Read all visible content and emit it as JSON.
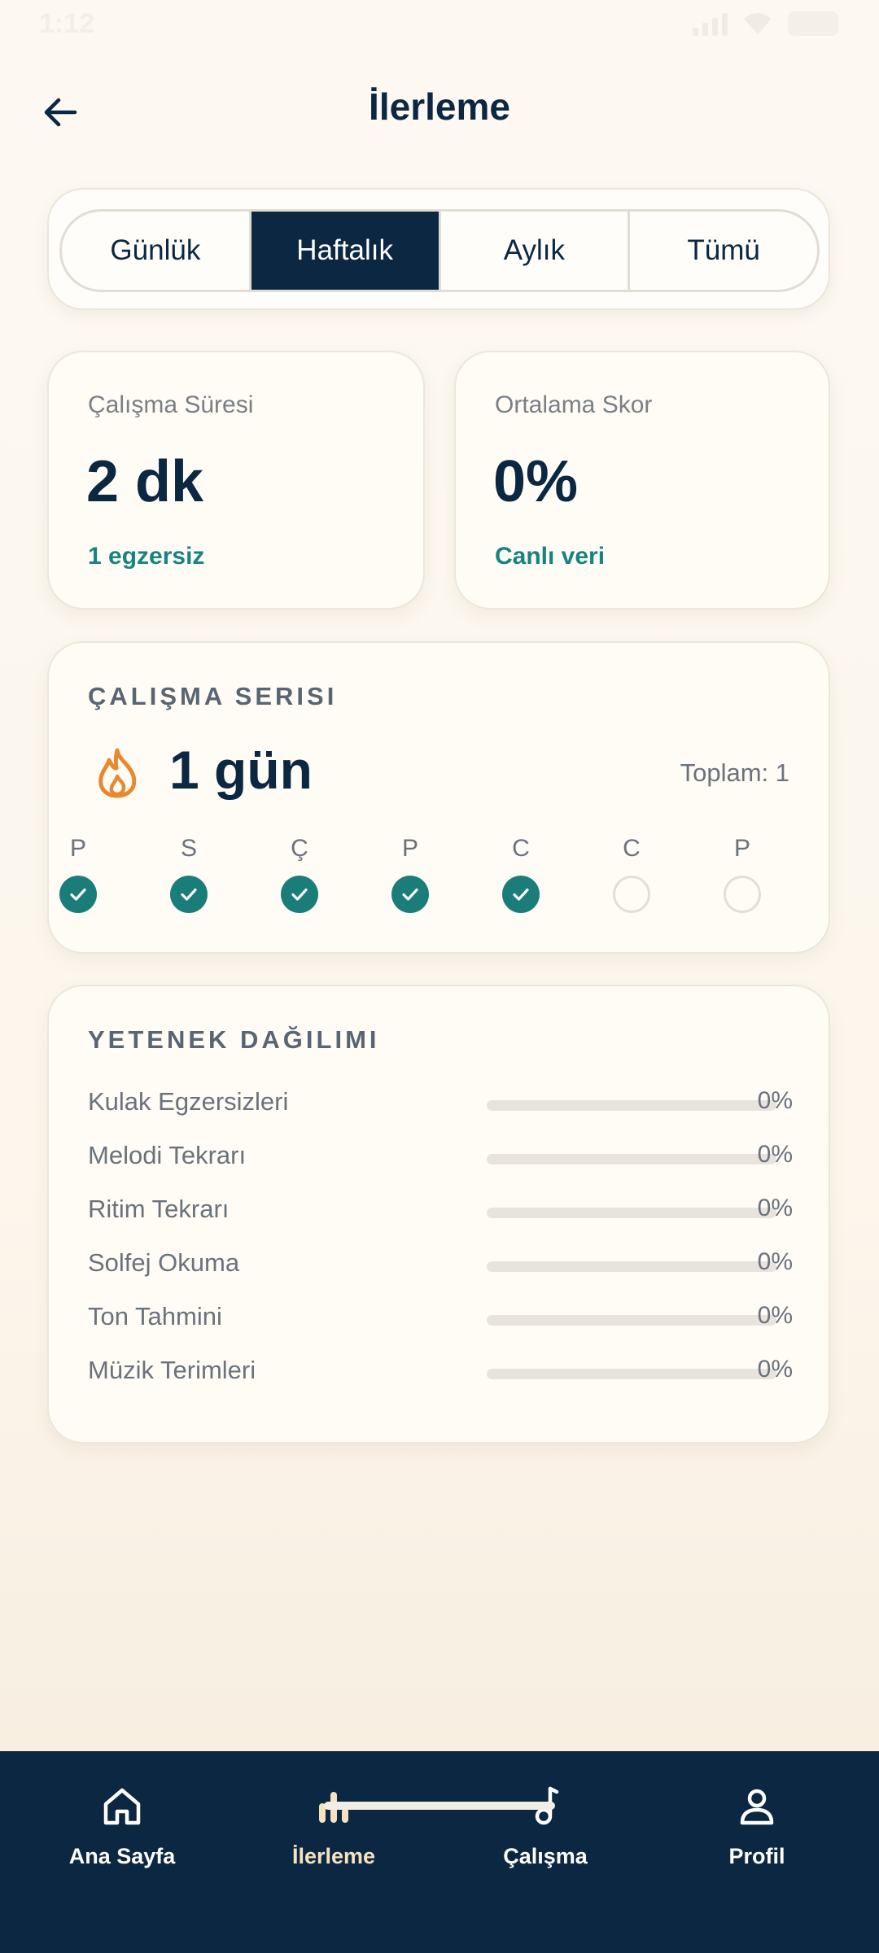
{
  "status_bar": {
    "time": "1:12"
  },
  "header": {
    "title": "İlerleme"
  },
  "period_tabs": [
    {
      "label": "Günlük",
      "active": false
    },
    {
      "label": "Haftalık",
      "active": true
    },
    {
      "label": "Aylık",
      "active": false
    },
    {
      "label": "Tümü",
      "active": false
    }
  ],
  "stats": {
    "study_time": {
      "label": "Çalışma Süresi",
      "value": "2 dk",
      "sub": "1 egzersiz"
    },
    "avg_score": {
      "label": "Ortalama Skor",
      "value": "0%",
      "sub": "Canlı veri"
    }
  },
  "streak": {
    "title": "ÇALIŞMA SERISI",
    "value": "1 gün",
    "total": "Toplam: 1",
    "days": [
      {
        "label": "P",
        "done": true
      },
      {
        "label": "S",
        "done": true
      },
      {
        "label": "Ç",
        "done": true
      },
      {
        "label": "P",
        "done": true
      },
      {
        "label": "C",
        "done": true
      },
      {
        "label": "C",
        "done": false
      },
      {
        "label": "P",
        "done": false
      }
    ]
  },
  "skills": {
    "title": "YETENEK DAĞILIMI",
    "items": [
      {
        "name": "Kulak Egzersizleri",
        "percent": 0,
        "percent_label": "0%"
      },
      {
        "name": "Melodi Tekrarı",
        "percent": 0,
        "percent_label": "0%"
      },
      {
        "name": "Ritim Tekrarı",
        "percent": 0,
        "percent_label": "0%"
      },
      {
        "name": "Solfej Okuma",
        "percent": 0,
        "percent_label": "0%"
      },
      {
        "name": "Ton Tahmini",
        "percent": 0,
        "percent_label": "0%"
      },
      {
        "name": "Müzik Terimleri",
        "percent": 0,
        "percent_label": "0%"
      }
    ]
  },
  "bottom_nav": [
    {
      "label": "Ana Sayfa",
      "icon": "home-icon",
      "active": false
    },
    {
      "label": "İlerleme",
      "icon": "bar-chart-icon",
      "active": true
    },
    {
      "label": "Çalışma",
      "icon": "music-note-icon",
      "active": false
    },
    {
      "label": "Profil",
      "icon": "person-icon",
      "active": false
    }
  ],
  "colors": {
    "navy": "#0b2742",
    "teal": "#1b7d7a",
    "flame": "#e8892f",
    "active_nav": "#f6e2c0"
  }
}
